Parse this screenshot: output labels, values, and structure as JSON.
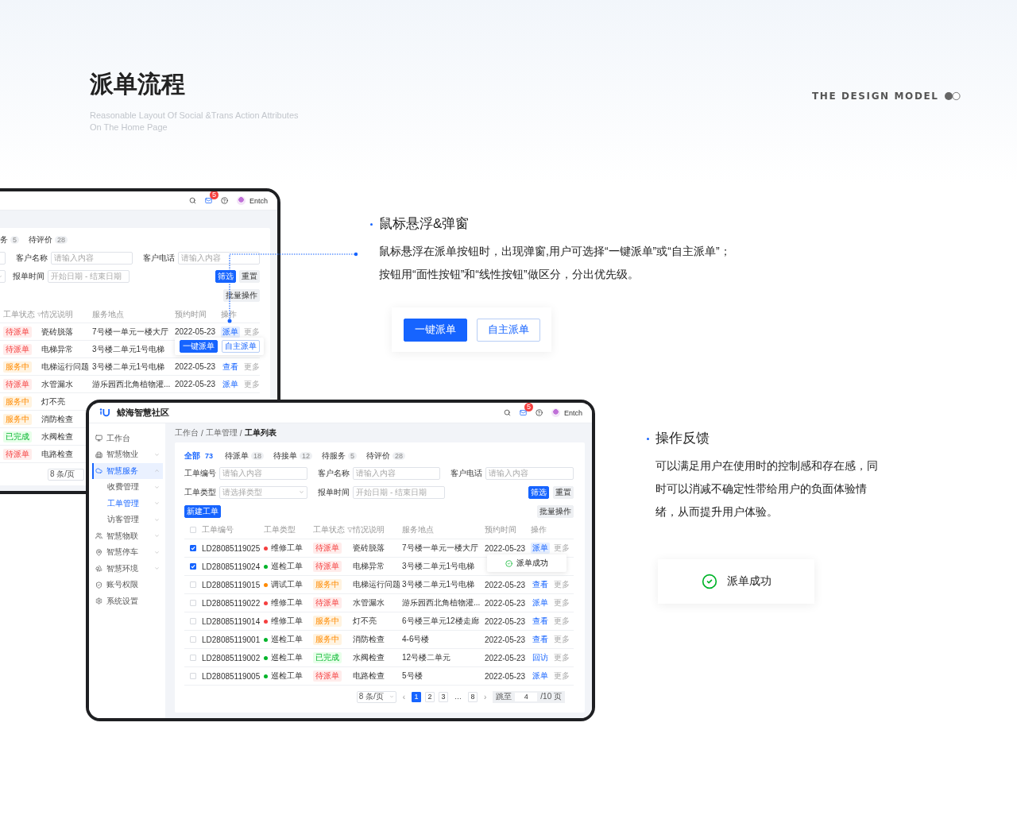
{
  "header": {
    "title": "派单流程",
    "subtitle": [
      "Reasonable Layout Of Social &Trans Action Attributes",
      "On The Home Page"
    ],
    "brand": "THE DESIGN MODEL"
  },
  "back_screen": {
    "user": "Entch",
    "mail_badge": "5",
    "tabs": [
      {
        "label": "务",
        "count": "5",
        "selected": false
      },
      {
        "label": "待评价",
        "count": "28",
        "selected": false
      }
    ],
    "fields": [
      {
        "label": "客户名称",
        "placeholder": "请输入内容"
      },
      {
        "label": "客户电话",
        "placeholder": "请输入内容"
      }
    ],
    "date_filter": {
      "label": "报单时间",
      "start": "开始日期",
      "separator": "-",
      "end": "结束日期"
    },
    "filter_button": "筛选",
    "reset_button": "重置",
    "batch_button": "批量操作",
    "columns": [
      {
        "label": "工单状态",
        "filterable": true
      },
      {
        "label": "情况说明",
        "filterable": false
      },
      {
        "label": "服务地点",
        "filterable": false
      },
      {
        "label": "预约时间",
        "filterable": false
      },
      {
        "label": "操作",
        "filterable": false
      }
    ],
    "rows": [
      {
        "status": {
          "label": "待派单",
          "kind": "pending"
        },
        "description": "瓷砖脱落",
        "location": "7号楼一单元一楼大厅",
        "time": "2022-05-23",
        "actions": [
          {
            "label": "派单",
            "kind": "link",
            "highlighted": true
          },
          {
            "label": "更多",
            "kind": "muted",
            "highlighted": false
          }
        ]
      },
      {
        "status": {
          "label": "待派单",
          "kind": "pending"
        },
        "description": "电梯异常",
        "location": "3号楼二单元1号电梯"
      },
      {
        "status": {
          "label": "服务中",
          "kind": "serving"
        },
        "description": "电梯运行问题",
        "location": "3号楼二单元1号电梯",
        "time": "2022-05-23",
        "actions": [
          {
            "label": "查看",
            "kind": "link",
            "highlighted": false
          },
          {
            "label": "更多",
            "kind": "muted",
            "highlighted": false
          }
        ]
      },
      {
        "status": {
          "label": "待派单",
          "kind": "pending"
        },
        "description": "水管漏水",
        "location": "游乐园西北角植物灌...",
        "time": "2022-05-23",
        "actions": [
          {
            "label": "派单",
            "kind": "link",
            "highlighted": false
          },
          {
            "label": "更多",
            "kind": "muted",
            "highlighted": false
          }
        ]
      },
      {
        "status": {
          "label": "服务中",
          "kind": "serving"
        },
        "description": "灯不亮"
      },
      {
        "status": {
          "label": "服务中",
          "kind": "serving"
        },
        "description": "消防检查"
      },
      {
        "status": {
          "label": "已完成",
          "kind": "done"
        },
        "description": "水阀检查"
      },
      {
        "status": {
          "label": "待派单",
          "kind": "pending"
        },
        "description": "电路检查"
      }
    ],
    "popup": [
      {
        "label": "一键派单",
        "kind": "primary"
      },
      {
        "label": "自主派单",
        "kind": "outline"
      }
    ],
    "page_size": "8 条/页"
  },
  "front_screen": {
    "app_name": "鲸海智慧社区",
    "user": "Entch",
    "mail_badge": "5",
    "sidebar": [
      {
        "label": "工作台",
        "kind": "item",
        "selected": false
      },
      {
        "label": "智慧物业",
        "kind": "group",
        "selected": false,
        "expanded": false
      },
      {
        "label": "智慧服务",
        "kind": "group",
        "selected": true,
        "expanded": true
      },
      {
        "label": "收费管理",
        "kind": "sub",
        "selected": false,
        "expanded": false
      },
      {
        "label": "工单管理",
        "kind": "sub",
        "selected": true,
        "expanded": false
      },
      {
        "label": "访客管理",
        "kind": "sub",
        "selected": false,
        "expanded": false
      },
      {
        "label": "智慧物联",
        "kind": "group",
        "selected": false,
        "expanded": false
      },
      {
        "label": "智慧停车",
        "kind": "group",
        "selected": false,
        "expanded": false
      },
      {
        "label": "智慧环境",
        "kind": "group",
        "selected": false,
        "expanded": false
      },
      {
        "label": "账号权限",
        "kind": "item",
        "selected": false
      },
      {
        "label": "系统设置",
        "kind": "item",
        "selected": false
      }
    ],
    "breadcrumb": [
      "工作台",
      "工单管理",
      "工单列表"
    ],
    "breadcrumb_separator": "/",
    "tabs": [
      {
        "label": "全部",
        "count": "73",
        "selected": true
      },
      {
        "label": "待派单",
        "count": "18",
        "selected": false
      },
      {
        "label": "待接单",
        "count": "12",
        "selected": false
      },
      {
        "label": "待服务",
        "count": "5",
        "selected": false
      },
      {
        "label": "待评价",
        "count": "28",
        "selected": false
      }
    ],
    "fields": [
      {
        "label": "工单编号",
        "placeholder": "请输入内容"
      },
      {
        "label": "客户名称",
        "placeholder": "请输入内容"
      },
      {
        "label": "客户电话",
        "placeholder": "请输入内容"
      }
    ],
    "type_select": {
      "label": "工单类型",
      "placeholder": "请选择类型"
    },
    "date_filter": {
      "label": "报单时间",
      "start": "开始日期",
      "separator": "-",
      "end": "结束日期"
    },
    "filter_button": "筛选",
    "reset_button": "重置",
    "create_button": "新建工单",
    "batch_button": "批量操作",
    "header_checked": false,
    "columns": [
      {
        "label": "工单编号",
        "filterable": false
      },
      {
        "label": "工单类型",
        "filterable": false
      },
      {
        "label": "工单状态",
        "filterable": true
      },
      {
        "label": "情况说明",
        "filterable": false
      },
      {
        "label": "服务地点",
        "filterable": false
      },
      {
        "label": "预约时间",
        "filterable": false
      },
      {
        "label": "操作",
        "filterable": false
      }
    ],
    "rows": [
      {
        "checked": true,
        "id": "LD28085119025",
        "type": {
          "label": "维修工单",
          "color": "#f53f3f"
        },
        "status": {
          "label": "待派单",
          "kind": "pending"
        },
        "description": "瓷砖脱落",
        "location": "7号楼一单元一楼大厅",
        "time": "2022-05-23",
        "actions": [
          {
            "label": "派单",
            "kind": "link",
            "highlighted": true
          },
          {
            "label": "更多",
            "kind": "muted",
            "highlighted": false
          }
        ]
      },
      {
        "checked": true,
        "id": "LD28085119024",
        "type": {
          "label": "巡检工单",
          "color": "#00b42a"
        },
        "status": {
          "label": "待派单",
          "kind": "pending"
        },
        "description": "电梯异常",
        "location": "3号楼二单元1号电梯"
      },
      {
        "checked": false,
        "id": "LD28085119015",
        "type": {
          "label": "调试工单",
          "color": "#ff8a00"
        },
        "status": {
          "label": "服务中",
          "kind": "serving"
        },
        "description": "电梯运行问题",
        "location": "3号楼二单元1号电梯",
        "time": "2022-05-23",
        "actions": [
          {
            "label": "查看",
            "kind": "link",
            "highlighted": false
          },
          {
            "label": "更多",
            "kind": "muted",
            "highlighted": false
          }
        ]
      },
      {
        "checked": false,
        "id": "LD28085119022",
        "type": {
          "label": "维修工单",
          "color": "#f53f3f"
        },
        "status": {
          "label": "待派单",
          "kind": "pending"
        },
        "description": "水管漏水",
        "location": "游乐园西北角植物灌...",
        "time": "2022-05-23",
        "actions": [
          {
            "label": "派单",
            "kind": "link",
            "highlighted": false
          },
          {
            "label": "更多",
            "kind": "muted",
            "highlighted": false
          }
        ]
      },
      {
        "checked": false,
        "id": "LD28085119014",
        "type": {
          "label": "维修工单",
          "color": "#f53f3f"
        },
        "status": {
          "label": "服务中",
          "kind": "serving"
        },
        "description": "灯不亮",
        "location": "6号楼三单元12楼走廊",
        "time": "2022-05-23",
        "actions": [
          {
            "label": "查看",
            "kind": "link",
            "highlighted": false
          },
          {
            "label": "更多",
            "kind": "muted",
            "highlighted": false
          }
        ]
      },
      {
        "checked": false,
        "id": "LD28085119001",
        "type": {
          "label": "巡检工单",
          "color": "#00b42a"
        },
        "status": {
          "label": "服务中",
          "kind": "serving"
        },
        "description": "消防检查",
        "location": "4-6号楼",
        "time": "2022-05-23",
        "actions": [
          {
            "label": "查看",
            "kind": "link",
            "highlighted": false
          },
          {
            "label": "更多",
            "kind": "muted",
            "highlighted": false
          }
        ]
      },
      {
        "checked": false,
        "id": "LD28085119002",
        "type": {
          "label": "巡检工单",
          "color": "#00b42a"
        },
        "status": {
          "label": "已完成",
          "kind": "done"
        },
        "description": "水阀检查",
        "location": "12号楼二单元",
        "time": "2022-05-23",
        "actions": [
          {
            "label": "回访",
            "kind": "link",
            "highlighted": false
          },
          {
            "label": "更多",
            "kind": "muted",
            "highlighted": false
          }
        ]
      },
      {
        "checked": false,
        "id": "LD28085119005",
        "type": {
          "label": "巡检工单",
          "color": "#00b42a"
        },
        "status": {
          "label": "待派单",
          "kind": "pending"
        },
        "description": "电路检查",
        "location": "5号楼",
        "time": "2022-05-23",
        "actions": [
          {
            "label": "派单",
            "kind": "link",
            "highlighted": false
          },
          {
            "label": "更多",
            "kind": "muted",
            "highlighted": false
          }
        ]
      }
    ],
    "toast": "派单成功",
    "pagination": {
      "page_size": "8 条/页",
      "prev": "‹",
      "next": "›",
      "pages": [
        {
          "label": "1",
          "kind": "page",
          "selected": true
        },
        {
          "label": "2",
          "kind": "page",
          "selected": false
        },
        {
          "label": "3",
          "kind": "page",
          "selected": false
        },
        {
          "label": "…",
          "kind": "ellipsis",
          "selected": false
        },
        {
          "label": "8",
          "kind": "page",
          "selected": false
        }
      ],
      "jump_label": "跳至",
      "jump_value": "4",
      "total": "/10 页"
    }
  },
  "notes": [
    {
      "title": "鼠标悬浮&弹窗",
      "lines": [
        "鼠标悬浮在派单按钮时，出现弹窗,用户可选择“一键派单”或“自主派单”；",
        "按钮用“面性按钮”和“线性按钮”做区分，分出优先级。"
      ]
    },
    {
      "title": "操作反馈",
      "lines": [
        "可以满足用户在使用时的控制感和存在感，同",
        "时可以消减不确定性带给用户的负面体验情",
        "绪，从而提升用户体验。"
      ]
    }
  ],
  "demo_buttons": [
    {
      "label": "一键派单",
      "kind": "primary"
    },
    {
      "label": "自主派单",
      "kind": "outline"
    }
  ],
  "demo_toast": "派单成功"
}
